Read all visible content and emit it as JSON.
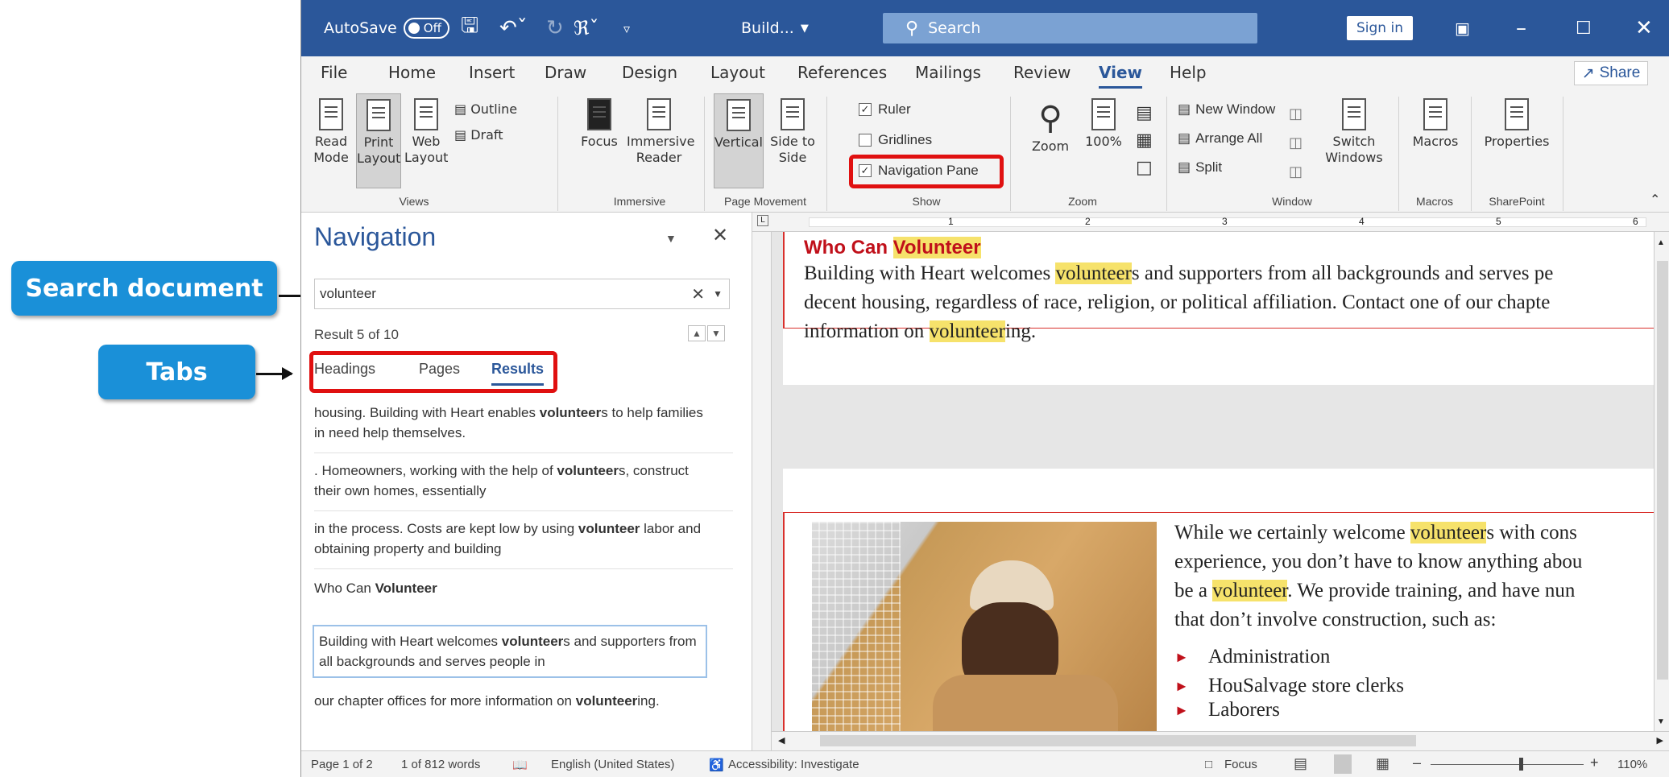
{
  "callouts": {
    "search_document": "Search document",
    "tabs": "Tabs"
  },
  "titlebar": {
    "autosave_label": "AutoSave",
    "autosave_state": "Off",
    "doc_title": "Build...",
    "search_label": "Search",
    "signin_label": "Sign in"
  },
  "menu": {
    "tabs": [
      "File",
      "Home",
      "Insert",
      "Draw",
      "Design",
      "Layout",
      "References",
      "Mailings",
      "Review",
      "View",
      "Help"
    ],
    "active": "View",
    "share_label": "Share"
  },
  "ribbon": {
    "views": {
      "read_mode": "Read Mode",
      "print_layout": "Print Layout",
      "web_layout": "Web Layout",
      "outline": "Outline",
      "draft": "Draft",
      "group_label": "Views"
    },
    "immersive": {
      "focus": "Focus",
      "immersive_reader": "Immersive Reader",
      "group_label": "Immersive"
    },
    "page_movement": {
      "vertical": "Vertical",
      "side_to_side": "Side to Side",
      "group_label": "Page Movement"
    },
    "show": {
      "ruler": "Ruler",
      "gridlines": "Gridlines",
      "navigation_pane": "Navigation Pane",
      "ruler_checked": true,
      "gridlines_checked": false,
      "navigation_pane_checked": true,
      "group_label": "Show"
    },
    "zoom": {
      "zoom": "Zoom",
      "zoom_100": "100%",
      "group_label": "Zoom"
    },
    "window": {
      "new_window": "New Window",
      "arrange_all": "Arrange All",
      "split": "Split",
      "switch_windows": "Switch Windows",
      "group_label": "Window"
    },
    "macros": {
      "macros": "Macros",
      "group_label": "Macros"
    },
    "sharepoint": {
      "properties": "Properties",
      "group_label": "SharePoint"
    }
  },
  "navigation": {
    "title": "Navigation",
    "search_value": "volunteer",
    "result_counter": "Result 5 of 10",
    "tabs": [
      "Headings",
      "Pages",
      "Results"
    ],
    "active_tab": "Results",
    "results": [
      {
        "before": "housing. Building with Heart enables ",
        "match": "volunteer",
        "after": "s to help families in need help themselves."
      },
      {
        "before": ". Homeowners, working with the help of ",
        "match": "volunteer",
        "after": "s, construct their own homes, essentially"
      },
      {
        "before": "in the process. Costs are kept low by using ",
        "match": "volunteer",
        "after": " labor and obtaining property and building"
      },
      {
        "before": "Who Can ",
        "match": "Volunteer",
        "after": ""
      },
      {
        "before": "Building with Heart welcomes ",
        "match": "volunteer",
        "after": "s and supporters from all backgrounds and serves people in"
      },
      {
        "before": "our chapter offices for more information on ",
        "match": "volunteer",
        "after": "ing."
      }
    ]
  },
  "document": {
    "heading_before": "Who Can ",
    "heading_match": "Volunteer",
    "para1_a": "Building with Heart welcomes ",
    "para1_match": "volunteer",
    "para1_b": "s and supporters from all backgrounds and serves pe",
    "para1_line2": "decent housing, regardless of race, religion, or political affiliation. Contact one of our chapte",
    "para1_line3_a": "information on ",
    "para1_line3_match": "volunteer",
    "para1_line3_b": "ing.",
    "para2_line1_a": "While we certainly welcome ",
    "para2_line1_match": "volunteer",
    "para2_line1_b": "s with cons",
    "para2_line2": "experience, you don’t have to know anything abou",
    "para2_line3_a": "be a ",
    "para2_line3_match": "volunteer",
    "para2_line3_b": ". We provide training, and have nun",
    "para2_line4": "that don’t involve construction, such as:",
    "bullets": [
      "Administration",
      "HouSalvage store clerks",
      "Laborers"
    ]
  },
  "ruler_numbers": [
    "1",
    "2",
    "3",
    "4",
    "5",
    "6"
  ],
  "statusbar": {
    "page": "Page 1 of 2",
    "words": "1 of 812 words",
    "language": "English (United States)",
    "accessibility": "Accessibility: Investigate",
    "focus": "Focus",
    "zoom_level": "110%"
  },
  "colors": {
    "title_bar": "#2b579a",
    "callout": "#1a90d8",
    "highlight_box": "#e01010",
    "search_highlight": "#f6e26b"
  }
}
